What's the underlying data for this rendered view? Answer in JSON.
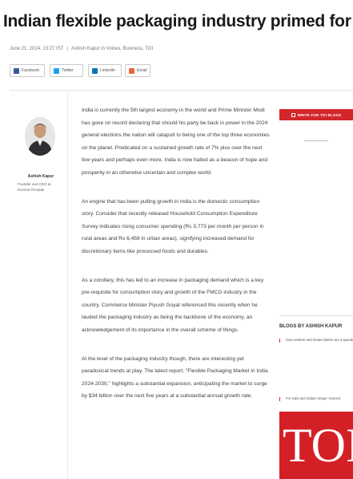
{
  "article": {
    "title": "Indian flexible packaging industry primed for stellar growth",
    "date": "June 21, 2024, 13:27 IST",
    "byline": "Ashish Kapur in Voices, Business, TOI"
  },
  "share": [
    {
      "name": "facebook",
      "label": "Facebook",
      "color": "#3b5998"
    },
    {
      "name": "twitter",
      "label": "Twitter",
      "color": "#1da1f2"
    },
    {
      "name": "linkedin",
      "label": "LinkedIn",
      "color": "#0077b5"
    },
    {
      "name": "email",
      "label": "Email",
      "color": "#e8663d"
    }
  ],
  "author": {
    "name": "Ashish Kapur",
    "role": "Founder and CEO at Everest Flexipak"
  },
  "body": {
    "paragraphs": [
      "India is currently the 5th largest economy in the world and Prime Minister Modi has gone on record declaring that should his party be back in power in the 2024 general elections the nation will catapult to being one of the top three economies on the planet. Predicated on a sustained growth rate of 7% plus over the next few years and perhaps even more, India is now hailed as a beacon of hope and prosperity in an otherwise uncertain and complex world.",
      "An engine that has been pulling growth in India is the domestic consumption story. Consider that recently released Household Consumption Expenditure Survey indicates rising consumer spending (Rs 3,773 per month per person in rural areas and Rs 6,459 in urban areas), signifying increased demand for discretionary items like processed foods and durables.",
      "As a corollary, this has led to an increase in packaging demand which is a key pre-requisite for consumption story and growth of the FMCG industry in the country. Commerce Minister Piyush Goyal referenced this recently when he lauded the packaging industry as being the backbone of the economy, an acknowledgement of its importance in the overall scheme of things.",
      "At the level of the packaging industry though, there are interesting yet paradoxical trends at play. The latest report, \"Flexible Packaging Market in India 2024-2030,\" highlights a substantial expansion, anticipating the market to surge by $34 billion over the next five years at a substantial annual growth rate."
    ]
  },
  "sidebar": {
    "cta_label": "WRITE FOR TOI BLOGS",
    "blogs_title": "BLOGS BY ASHISH KAPUR",
    "blog_items": [
      "How weather and heated plastic are a quandary for agrochemical businesses in South India",
      "For India and Indian merger: Everest"
    ],
    "logo_text": "TOI",
    "colors": {
      "accent": "#d3262a",
      "logo_bg": "#d32027"
    }
  }
}
